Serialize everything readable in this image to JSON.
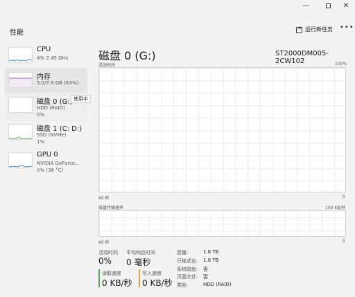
{
  "header": {
    "title": "性能",
    "run_task": "运行新任务",
    "more": "•••"
  },
  "window_controls": {
    "minimize": "—",
    "close": "✕"
  },
  "sidebar": {
    "items": [
      {
        "name": "CPU",
        "sub1": "4%  2.45 GHz",
        "sub2": ""
      },
      {
        "name": "内存",
        "sub1": "5.0/7.9 GB (63%)",
        "sub2": ""
      },
      {
        "name": "磁盘 0 (G:)",
        "sub1": "HDD (RAID)",
        "sub2": "0%"
      },
      {
        "name": "磁盘 1 (C: D:)",
        "sub1": "SSD (NVMe)",
        "sub2": "1%"
      },
      {
        "name": "GPU 0",
        "sub1": "NVIDIA GeForce…",
        "sub2": "0% (38 °C)"
      }
    ],
    "tooltip": "使用中"
  },
  "main": {
    "title": "磁盘 0 (G:)",
    "model": "ST2000DM005-2CW102",
    "chart1": {
      "label_left": "活动时间",
      "label_right": "100%",
      "bottom_left": "60 秒",
      "bottom_right": "0"
    },
    "chart2": {
      "label_left": "磁盘传输速率",
      "label_right": "100 KB/秒",
      "bottom_left": "60 秒",
      "bottom_right": "0"
    }
  },
  "stats": {
    "active_time_label": "活动时间",
    "active_time_value": "0%",
    "avg_response_label": "平均响应时间",
    "avg_response_value": "0 毫秒",
    "read_label": "读取速度",
    "read_value": "0 KB/秒",
    "write_label": "写入速度",
    "write_value": "0 KB/秒"
  },
  "info": [
    {
      "key": "容量:",
      "value": "1.8 TB"
    },
    {
      "key": "已格式化:",
      "value": "1.8 TB"
    },
    {
      "key": "系统磁盘:",
      "value": "否"
    },
    {
      "key": "页面文件:",
      "value": "否"
    },
    {
      "key": "类型:",
      "value": "HDD (RAID)"
    }
  ],
  "colors": {
    "cpu": "#3c8fd1",
    "memory": "#9b5fb5",
    "disk": "#5ea85e",
    "gpu": "#3c8fd1",
    "write": "#e6a23c"
  }
}
